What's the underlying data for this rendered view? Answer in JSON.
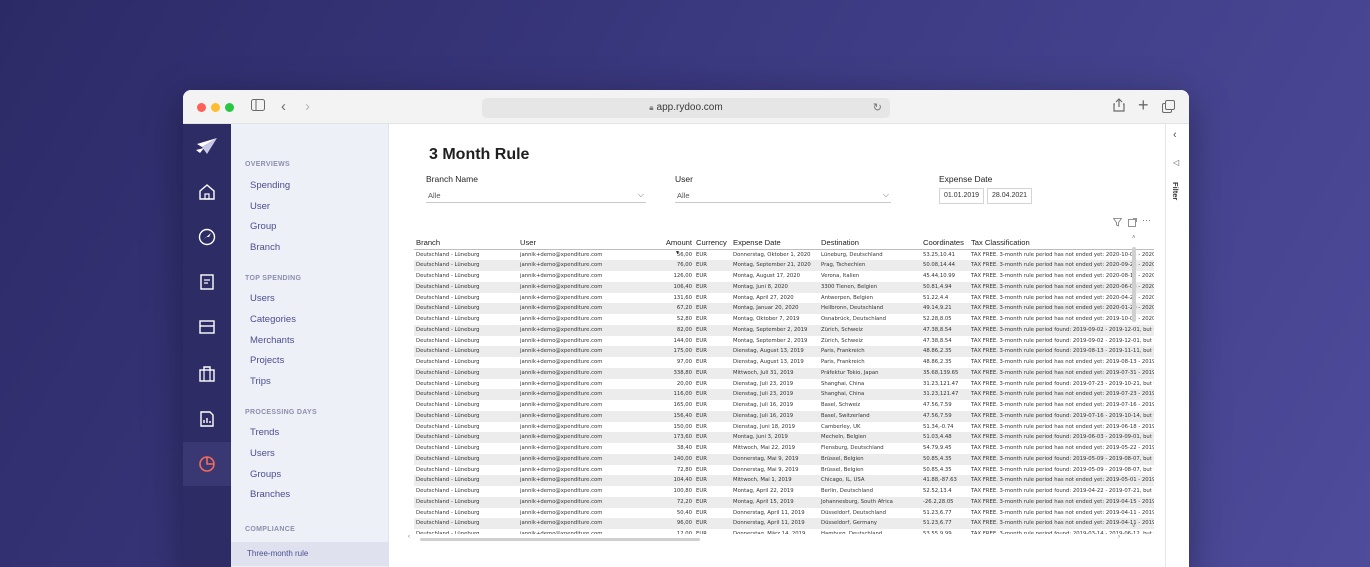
{
  "browser": {
    "url": "app.rydoo.com"
  },
  "sidebar": {
    "sections": [
      {
        "title": "OVERVIEWS",
        "items": [
          "Spending",
          "User",
          "Group",
          "Branch"
        ]
      },
      {
        "title": "TOP SPENDING",
        "items": [
          "Users",
          "Categories",
          "Merchants",
          "Projects",
          "Trips"
        ]
      },
      {
        "title": "PROCESSING DAYS",
        "items": [
          "Trends",
          "Users",
          "Groups",
          "Branches"
        ]
      },
      {
        "title": "COMPLIANCE",
        "items": [
          "Three-month rule"
        ]
      }
    ]
  },
  "rail": {
    "items": [
      "home-icon",
      "travel-icon",
      "expense-icon",
      "card-icon",
      "briefcase-icon",
      "report-icon",
      "analytics-icon"
    ],
    "active": "analytics-icon",
    "accent": "#f36b5b"
  },
  "report": {
    "title": "3 Month Rule",
    "filters": {
      "branch_label": "Branch Name",
      "branch_value": "Alle",
      "user_label": "User",
      "user_value": "Alle",
      "date_label": "Expense Date",
      "date_from": "01.01.2019",
      "date_to": "28.04.2021"
    },
    "filter_pane_label": "Filter",
    "columns": [
      "Branch",
      "User",
      "Amount",
      "Currency",
      "Expense Date",
      "Destination",
      "Coordinates",
      "Tax Classification"
    ],
    "rows": [
      [
        "Deutschland - Lüneburg",
        "jannik+demo@xpenditure.com",
        "56,00",
        "EUR",
        "Donnerstag, Oktober 1, 2020",
        "Lüneburg, Deutschland",
        "53.25,10.41",
        "TAX FREE. 3-month rule period has not ended yet: 2020-10-01 - 2020-12-30"
      ],
      [
        "Deutschland - Lüneburg",
        "jannik+demo@xpenditure.com",
        "76,00",
        "EUR",
        "Montag, September 21, 2020",
        "Prag, Tschechien",
        "50.08,14.44",
        "TAX FREE. 3-month rule period has not ended yet: 2020-09-21 - 2020-12-20"
      ],
      [
        "Deutschland - Lüneburg",
        "jannik+demo@xpenditure.com",
        "126,00",
        "EUR",
        "Montag, August 17, 2020",
        "Verona, Italien",
        "45.44,10.99",
        "TAX FREE. 3-month rule period has not ended yet: 2020-08-17 - 2020-11-15"
      ],
      [
        "Deutschland - Lüneburg",
        "jannik+demo@xpenditure.com",
        "106,40",
        "EUR",
        "Montag, Juni 8, 2020",
        "3300 Tienen, Belgien",
        "50.81,4.94",
        "TAX FREE. 3-month rule period has not ended yet: 2020-06-08 - 2020-09-06"
      ],
      [
        "Deutschland - Lüneburg",
        "jannik+demo@xpenditure.com",
        "131,60",
        "EUR",
        "Montag, April 27, 2020",
        "Antwerpen, Belgien",
        "51.22,4.4",
        "TAX FREE. 3-month rule period has not ended yet: 2020-04-27 - 2020-07-26"
      ],
      [
        "Deutschland - Lüneburg",
        "jannik+demo@xpenditure.com",
        "67,20",
        "EUR",
        "Montag, Januar 20, 2020",
        "Heilbronn, Deutschland",
        "49.14,9.21",
        "TAX FREE. 3-month rule period has not ended yet: 2020-01-20 - 2020-04-19"
      ],
      [
        "Deutschland - Lüneburg",
        "jannik+demo@xpenditure.com",
        "52,80",
        "EUR",
        "Montag, Oktober 7, 2019",
        "Osnabrück, Deutschland",
        "52.28,8.05",
        "TAX FREE. 3-month rule period has not ended yet: 2019-10-07 - 2020-01-05"
      ],
      [
        "Deutschland - Lüneburg",
        "jannik+demo@xpenditure.com",
        "82,00",
        "EUR",
        "Montag, September 2, 2019",
        "Zürich, Schweiz",
        "47.38,8.54",
        "TAX FREE. 3-month rule period found: 2019-09-02 - 2019-12-01, but taxation"
      ],
      [
        "Deutschland - Lüneburg",
        "jannik+demo@xpenditure.com",
        "144,00",
        "EUR",
        "Montag, September 2, 2019",
        "Zürich, Schweiz",
        "47.38,8.54",
        "TAX FREE. 3-month rule period found: 2019-09-02 - 2019-12-01, but taxation"
      ],
      [
        "Deutschland - Lüneburg",
        "jannik+demo@xpenditure.com",
        "175,00",
        "EUR",
        "Dienstag, August 13, 2019",
        "Paris, Frankreich",
        "48.86,2.35",
        "TAX FREE. 3-month rule period found: 2019-08-13 - 2019-11-11, but taxation"
      ],
      [
        "Deutschland - Lüneburg",
        "jannik+demo@xpenditure.com",
        "97,00",
        "EUR",
        "Dienstag, August 13, 2019",
        "Paris, Frankreich",
        "48.86,2.35",
        "TAX FREE. 3-month rule period has not ended yet: 2019-08-13 - 2019-11-11"
      ],
      [
        "Deutschland - Lüneburg",
        "jannik+demo@xpenditure.com",
        "338,80",
        "EUR",
        "Mittwoch, Juli 31, 2019",
        "Präfektur Tokio, Japan",
        "35.68,139.65",
        "TAX FREE. 3-month rule period has not ended yet: 2019-07-31 - 2019-10-29"
      ],
      [
        "Deutschland - Lüneburg",
        "jannik+demo@xpenditure.com",
        "20,00",
        "EUR",
        "Dienstag, Juli 23, 2019",
        "Shanghai, China",
        "31.23,121.47",
        "TAX FREE. 3-month rule period found: 2019-07-23 - 2019-10-21, but taxation"
      ],
      [
        "Deutschland - Lüneburg",
        "jannik+demo@xpenditure.com",
        "116,00",
        "EUR",
        "Dienstag, Juli 23, 2019",
        "Shanghai, China",
        "31.23,121.47",
        "TAX FREE. 3-month rule period has not ended yet: 2019-07-23 - 2019-10-21"
      ],
      [
        "Deutschland - Lüneburg",
        "jannik+demo@xpenditure.com",
        "165,00",
        "EUR",
        "Dienstag, Juli 16, 2019",
        "Basel, Schweiz",
        "47.56,7.59",
        "TAX FREE. 3-month rule period has not ended yet: 2019-07-16 - 2019-10-14"
      ],
      [
        "Deutschland - Lüneburg",
        "jannik+demo@xpenditure.com",
        "156,40",
        "EUR",
        "Dienstag, Juli 16, 2019",
        "Basel, Switzerland",
        "47.56,7.59",
        "TAX FREE. 3-month rule period found: 2019-07-16 - 2019-10-14, but taxation"
      ],
      [
        "Deutschland - Lüneburg",
        "jannik+demo@xpenditure.com",
        "150,00",
        "EUR",
        "Dienstag, Juni 18, 2019",
        "Camberley, UK",
        "51.34,-0.74",
        "TAX FREE. 3-month rule period has not ended yet: 2019-06-18 - 2019-09-16"
      ],
      [
        "Deutschland - Lüneburg",
        "jannik+demo@xpenditure.com",
        "173,60",
        "EUR",
        "Montag, Juni 3, 2019",
        "Mecheln, Belgien",
        "51.03,4.48",
        "TAX FREE. 3-month rule period found: 2019-06-03 - 2019-09-01, but taxation"
      ],
      [
        "Deutschland - Lüneburg",
        "jannik+demo@xpenditure.com",
        "38,40",
        "EUR",
        "Mittwoch, Mai 22, 2019",
        "Flensburg, Deutschland",
        "54.79,9.45",
        "TAX FREE. 3-month rule period has not ended yet: 2019-05-22 - 2019-08-20"
      ],
      [
        "Deutschland - Lüneburg",
        "jannik+demo@xpenditure.com",
        "140,00",
        "EUR",
        "Donnerstag, Mai 9, 2019",
        "Brüssel, Belgien",
        "50.85,4.35",
        "TAX FREE. 3-month rule period found: 2019-05-09 - 2019-08-07, but taxation"
      ],
      [
        "Deutschland - Lüneburg",
        "jannik+demo@xpenditure.com",
        "72,80",
        "EUR",
        "Donnerstag, Mai 9, 2019",
        "Brüssel, Belgien",
        "50.85,4.35",
        "TAX FREE. 3-month rule period found: 2019-05-09 - 2019-08-07, but taxation"
      ],
      [
        "Deutschland - Lüneburg",
        "jannik+demo@xpenditure.com",
        "104,40",
        "EUR",
        "Mittwoch, Mai 1, 2019",
        "Chicago, IL, USA",
        "41.88,-87.63",
        "TAX FREE. 3-month rule period has not ended yet: 2019-05-01 - 2019-07-30"
      ],
      [
        "Deutschland - Lüneburg",
        "jannik+demo@xpenditure.com",
        "100,80",
        "EUR",
        "Montag, April 22, 2019",
        "Berlin, Deutschland",
        "52.52,13.4",
        "TAX FREE. 3-month rule period found: 2019-04-22 - 2019-07-21, but taxation"
      ],
      [
        "Deutschland - Lüneburg",
        "jannik+demo@xpenditure.com",
        "72,20",
        "EUR",
        "Montag, April 15, 2019",
        "Johannesburg, South Africa",
        "-26.2,28.05",
        "TAX FREE. 3-month rule period has not ended yet: 2019-04-15 - 2019-07-14"
      ],
      [
        "Deutschland - Lüneburg",
        "jannik+demo@xpenditure.com",
        "50,40",
        "EUR",
        "Donnerstag, April 11, 2019",
        "Düsseldorf, Deutschland",
        "51.23,6.77",
        "TAX FREE. 3-month rule period has not ended yet: 2019-04-11 - 2019-07-10"
      ],
      [
        "Deutschland - Lüneburg",
        "jannik+demo@xpenditure.com",
        "96,00",
        "EUR",
        "Donnerstag, April 11, 2019",
        "Düsseldorf, Germany",
        "51.23,6.77",
        "TAX FREE. 3-month rule period has not ended yet: 2019-04-11 - 2019-07-10"
      ],
      [
        "Deutschland - Lüneburg",
        "jannik+demo@xpenditure.com",
        "12,00",
        "EUR",
        "Donnerstag, März 14, 2019",
        "Hamburg, Deutschland",
        "53.55,9.99",
        "TAX FREE. 3-month rule period found: 2019-03-14 - 2019-06-12, but taxation"
      ]
    ]
  }
}
